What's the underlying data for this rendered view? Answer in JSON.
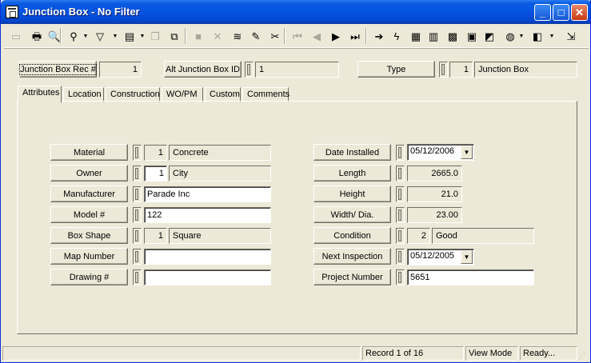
{
  "window": {
    "title": "Junction Box - No Filter"
  },
  "header": {
    "rec_label": "Junction Box Rec #",
    "rec_value": "1",
    "alt_id_label": "Alt Junction Box ID",
    "alt_id_value": "1",
    "type_label": "Type",
    "type_code": "1",
    "type_value": "Junction Box"
  },
  "tabs": [
    {
      "label": "Attributes"
    },
    {
      "label": "Location"
    },
    {
      "label": "Construction"
    },
    {
      "label": "WO/PM"
    },
    {
      "label": "Custom"
    },
    {
      "label": "Comments"
    }
  ],
  "left_fields": {
    "material": {
      "label": "Material",
      "code": "1",
      "value": "Concrete"
    },
    "owner": {
      "label": "Owner",
      "code": "1",
      "value": "City"
    },
    "manufacturer": {
      "label": "Manufacturer",
      "value": "Parade Inc"
    },
    "model": {
      "label": "Model #",
      "value": "122"
    },
    "box_shape": {
      "label": "Box Shape",
      "code": "1",
      "value": "Square"
    },
    "map_number": {
      "label": "Map Number",
      "value": ""
    },
    "drawing": {
      "label": "Drawing #",
      "value": ""
    }
  },
  "right_fields": {
    "date_installed": {
      "label": "Date Installed",
      "value": "05/12/2006"
    },
    "length": {
      "label": "Length",
      "value": "2665.0"
    },
    "height": {
      "label": "Height",
      "value": "21.0"
    },
    "width": {
      "label": "Width/ Dia.",
      "value": "23.00"
    },
    "condition": {
      "label": "Condition",
      "code": "2",
      "value": "Good"
    },
    "next_inspection": {
      "label": "Next Inspection",
      "value": "05/12/2005"
    },
    "project_number": {
      "label": "Project Number",
      "value": "5651"
    }
  },
  "status": {
    "record": "Record 1 of 16",
    "mode": "View Mode",
    "state": "Ready..."
  },
  "titlebar_buttons": {
    "minimize": "_",
    "maximize": "□",
    "close": "✕"
  },
  "toolbar": [
    {
      "name": "new-record-icon",
      "glyph": "▭",
      "disabled": true
    },
    {
      "name": "print-icon",
      "glyph": "🖶"
    },
    {
      "name": "print-preview-icon",
      "glyph": "🔍"
    },
    {
      "name": "binoculars-icon",
      "glyph": "⚲"
    },
    {
      "name": "filter-icon",
      "glyph": "▽"
    },
    {
      "name": "report-icon",
      "glyph": "▤"
    },
    {
      "name": "copy-record-icon",
      "glyph": "❐",
      "disabled": true
    },
    {
      "name": "duplicate-icon",
      "glyph": "⧉"
    },
    {
      "name": "save-icon",
      "glyph": "■",
      "disabled": true
    },
    {
      "name": "delete-icon",
      "glyph": "✕",
      "disabled": true
    },
    {
      "name": "layers-icon",
      "glyph": "≋"
    },
    {
      "name": "edit-pencil-icon",
      "glyph": "✎"
    },
    {
      "name": "cut-icon",
      "glyph": "✂"
    },
    {
      "name": "first-record-icon",
      "glyph": "⏮",
      "disabled": true
    },
    {
      "name": "previous-record-icon",
      "glyph": "◀",
      "disabled": true
    },
    {
      "name": "next-record-icon",
      "glyph": "▶"
    },
    {
      "name": "last-record-icon",
      "glyph": "⏭"
    },
    {
      "name": "go-to-arrow-icon",
      "glyph": "➔"
    },
    {
      "name": "lightning-icon",
      "glyph": "ϟ"
    },
    {
      "name": "hierarchy-icon",
      "glyph": "▦"
    },
    {
      "name": "tree-icon",
      "glyph": "▥"
    },
    {
      "name": "map-icon",
      "glyph": "▩"
    },
    {
      "name": "calculator-icon",
      "glyph": "▣"
    },
    {
      "name": "gis-icon",
      "glyph": "◩"
    },
    {
      "name": "globe-icon",
      "glyph": "◍"
    },
    {
      "name": "book-icon",
      "glyph": "◧"
    },
    {
      "name": "exit-icon",
      "glyph": "⇲"
    }
  ]
}
